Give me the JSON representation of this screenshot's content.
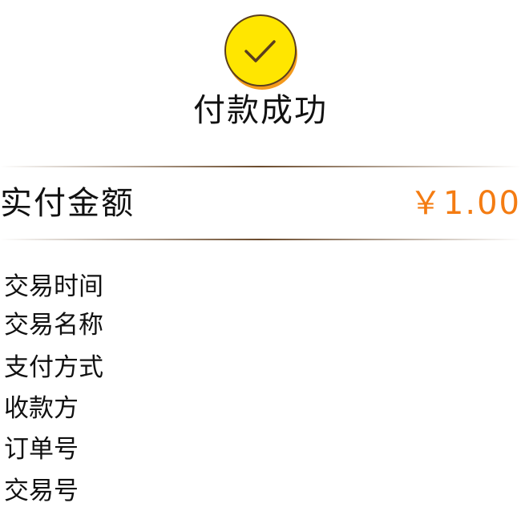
{
  "header": {
    "status_icon": "check-icon",
    "title": "付款成功"
  },
  "amount": {
    "label": "实付金额",
    "value": "￥1.00"
  },
  "details": {
    "items": [
      {
        "label": "交易时间"
      },
      {
        "label": "交易名称"
      },
      {
        "label": "支付方式"
      },
      {
        "label": "收款方"
      },
      {
        "label": "订单号"
      },
      {
        "label": "交易号"
      }
    ]
  },
  "colors": {
    "badge_fill": "#ffe600",
    "badge_shadow": "#f39a1c",
    "badge_outline": "#5a3e1e",
    "amount_accent": "#f47c12",
    "divider": "#6b4b2d"
  }
}
